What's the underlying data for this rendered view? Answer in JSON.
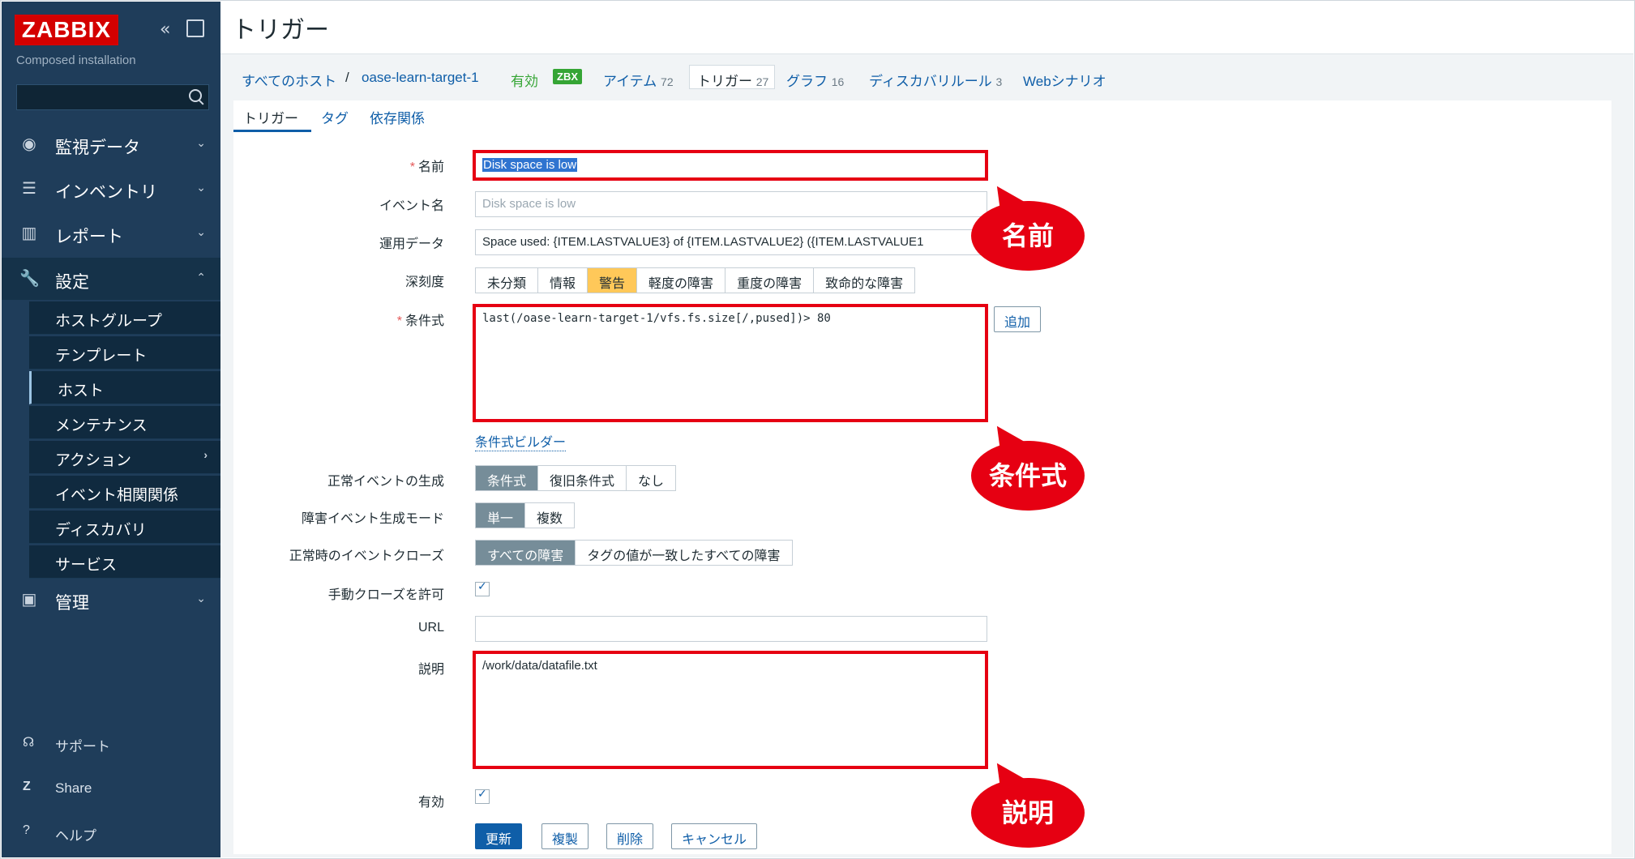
{
  "sidebar": {
    "logo": "ZABBIX",
    "subtitle": "Composed installation",
    "collapse_icon": "«",
    "menu": [
      {
        "icon": "◉",
        "label": "監視データ"
      },
      {
        "icon": "☰",
        "label": "インベントリ"
      },
      {
        "icon": "▥",
        "label": "レポート"
      },
      {
        "icon": "🔧",
        "label": "設定"
      },
      {
        "icon": "▣",
        "label": "管理"
      }
    ],
    "submenu": [
      "ホストグループ",
      "テンプレート",
      "ホスト",
      "メンテナンス",
      "アクション",
      "イベント相関関係",
      "ディスカバリ",
      "サービス"
    ],
    "footer": [
      {
        "icon": "☊",
        "label": "サポート"
      },
      {
        "icon": "Z",
        "label": "Share"
      },
      {
        "icon": "?",
        "label": "ヘルプ"
      }
    ]
  },
  "header": {
    "title": "トリガー"
  },
  "breadcrumb": {
    "all_hosts": "すべてのホスト",
    "sep": "/",
    "host": "oase-learn-target-1",
    "enabled": "有効",
    "zbx": "ZBX",
    "items": "アイテム",
    "items_count": "72",
    "triggers": "トリガー",
    "triggers_count": "27",
    "graphs": "グラフ",
    "graphs_count": "16",
    "discovery": "ディスカバリルール",
    "discovery_count": "3",
    "web": "Webシナリオ"
  },
  "tabs": [
    "トリガー",
    "タグ",
    "依存関係"
  ],
  "form": {
    "name_label": "名前",
    "name_value": "Disk space is low",
    "event_name_label": "イベント名",
    "event_name_placeholder": "Disk space is low",
    "opdata_label": "運用データ",
    "opdata_value": "Space used: {ITEM.LASTVALUE3} of {ITEM.LASTVALUE2} ({ITEM.LASTVALUE1",
    "severity_label": "深刻度",
    "severity_options": [
      "未分類",
      "情報",
      "警告",
      "軽度の障害",
      "重度の障害",
      "致命的な障害"
    ],
    "expression_label": "条件式",
    "expression_value": "last(/oase-learn-target-1/vfs.fs.size[/,pused])> 80",
    "add_button": "追加",
    "builder_link": "条件式ビルダー",
    "ok_event_label": "正常イベントの生成",
    "ok_event_options": [
      "条件式",
      "復旧条件式",
      "なし"
    ],
    "problem_mode_label": "障害イベント生成モード",
    "problem_mode_options": [
      "単一",
      "複数"
    ],
    "ok_close_label": "正常時のイベントクローズ",
    "ok_close_options": [
      "すべての障害",
      "タグの値が一致したすべての障害"
    ],
    "manual_close_label": "手動クローズを許可",
    "url_label": "URL",
    "description_label": "説明",
    "description_value": "/work/data/datafile.txt",
    "enabled_label": "有効",
    "buttons": [
      "更新",
      "複製",
      "削除",
      "キャンセル"
    ]
  },
  "annotations": {
    "name": "名前",
    "expression": "条件式",
    "description": "説明"
  }
}
